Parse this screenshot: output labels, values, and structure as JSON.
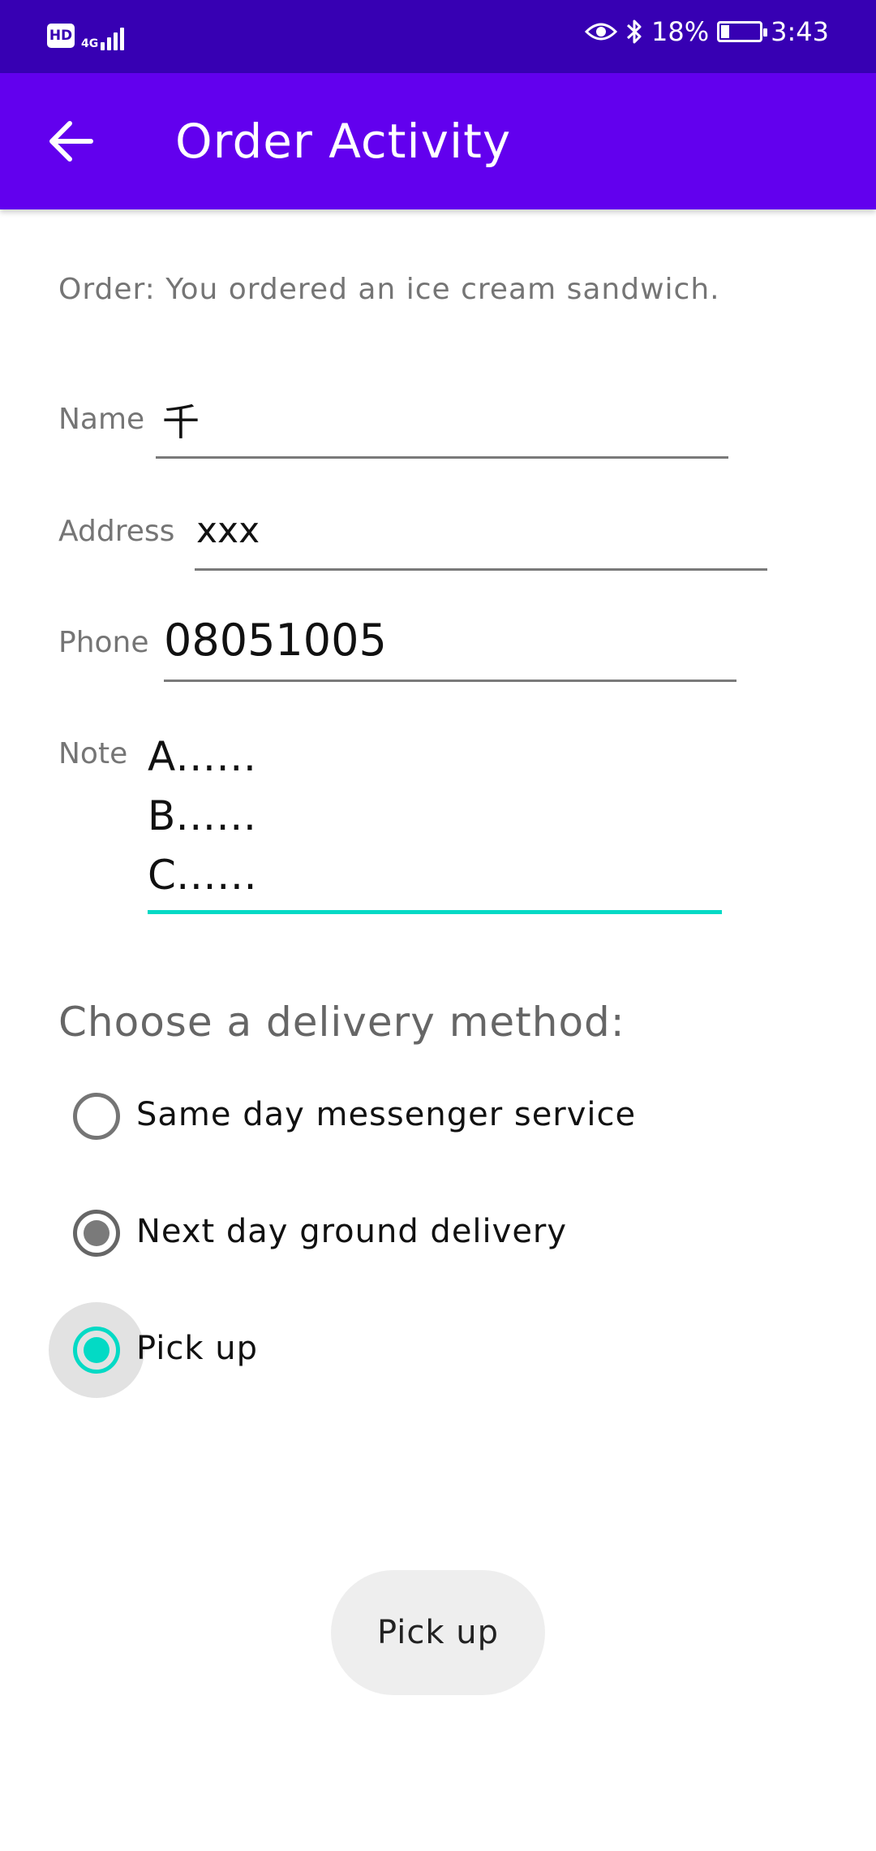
{
  "status_bar": {
    "hd": "HD",
    "network": "4G",
    "battery": "18%",
    "time": "3:43",
    "icons": [
      "signal-icon",
      "eye-icon",
      "bluetooth-icon",
      "battery-icon"
    ]
  },
  "app_bar": {
    "title": "Order Activity",
    "back_icon": "arrow-back-icon",
    "background": "#6200EE"
  },
  "order": {
    "text": "Order: You ordered an ice cream sandwich."
  },
  "form": {
    "name": {
      "label": "Name",
      "value": "千"
    },
    "address": {
      "label": "Address",
      "value": "xxx"
    },
    "phone": {
      "label": "Phone",
      "value": "08051005"
    },
    "note": {
      "label": "Note",
      "lines": [
        "A……",
        "B……",
        "C……"
      ]
    }
  },
  "delivery": {
    "title": "Choose a delivery method:",
    "options": [
      {
        "label": "Same day messenger service",
        "state": "unchecked"
      },
      {
        "label": "Next day ground delivery",
        "state": "disabled-checked"
      },
      {
        "label": "Pick up",
        "state": "checked"
      }
    ],
    "accent": "#03DAC5"
  },
  "button": {
    "label": "Pick up"
  }
}
